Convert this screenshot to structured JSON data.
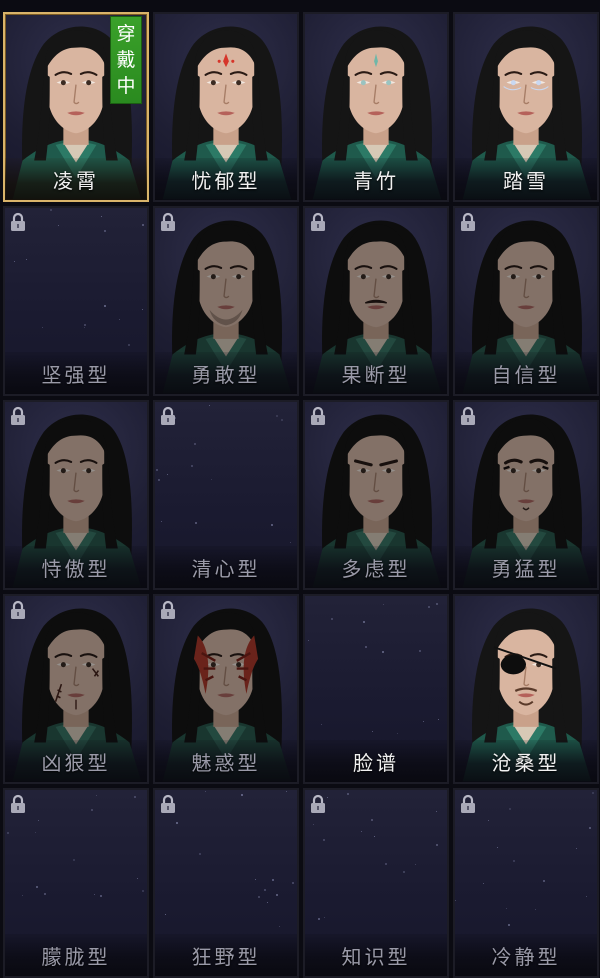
{
  "wearing_label": [
    "穿",
    "戴",
    "中"
  ],
  "styles": [
    {
      "name": "凌霄",
      "locked": false,
      "selected": true,
      "has_portrait": true,
      "variant": "base"
    },
    {
      "name": "忧郁型",
      "locked": false,
      "selected": false,
      "has_portrait": true,
      "variant": "forehead-mark"
    },
    {
      "name": "青竹",
      "locked": false,
      "selected": false,
      "has_portrait": true,
      "variant": "teal-mark"
    },
    {
      "name": "踏雪",
      "locked": false,
      "selected": false,
      "has_portrait": true,
      "variant": "silver-eyes"
    },
    {
      "name": "坚强型",
      "locked": true,
      "selected": false,
      "has_portrait": false,
      "variant": "none"
    },
    {
      "name": "勇敢型",
      "locked": true,
      "selected": false,
      "has_portrait": true,
      "variant": "stubble"
    },
    {
      "name": "果断型",
      "locked": true,
      "selected": false,
      "has_portrait": true,
      "variant": "mustache"
    },
    {
      "name": "自信型",
      "locked": true,
      "selected": false,
      "has_portrait": true,
      "variant": "base"
    },
    {
      "name": "恃傲型",
      "locked": true,
      "selected": false,
      "has_portrait": true,
      "variant": "base"
    },
    {
      "name": "清心型",
      "locked": true,
      "selected": false,
      "has_portrait": false,
      "variant": "none"
    },
    {
      "name": "多虑型",
      "locked": true,
      "selected": false,
      "has_portrait": true,
      "variant": "frown"
    },
    {
      "name": "勇猛型",
      "locked": true,
      "selected": false,
      "has_portrait": true,
      "variant": "fierce"
    },
    {
      "name": "凶狠型",
      "locked": true,
      "selected": false,
      "has_portrait": true,
      "variant": "scar"
    },
    {
      "name": "魅惑型",
      "locked": true,
      "selected": false,
      "has_portrait": true,
      "variant": "red-paint"
    },
    {
      "name": "脸谱",
      "locked": false,
      "selected": false,
      "has_portrait": false,
      "variant": "none"
    },
    {
      "name": "沧桑型",
      "locked": false,
      "selected": false,
      "has_portrait": true,
      "variant": "eyepatch"
    },
    {
      "name": "朦胧型",
      "locked": true,
      "selected": false,
      "has_portrait": false,
      "variant": "none"
    },
    {
      "name": "狂野型",
      "locked": true,
      "selected": false,
      "has_portrait": false,
      "variant": "none"
    },
    {
      "name": "知识型",
      "locked": true,
      "selected": false,
      "has_portrait": false,
      "variant": "none"
    },
    {
      "name": "冷静型",
      "locked": true,
      "selected": false,
      "has_portrait": false,
      "variant": "none"
    }
  ],
  "colors": {
    "selected_border": "#d9b46a",
    "wearing_tag": "#2f9a22",
    "robe": "#1f5a4c",
    "hair": "#151515"
  }
}
